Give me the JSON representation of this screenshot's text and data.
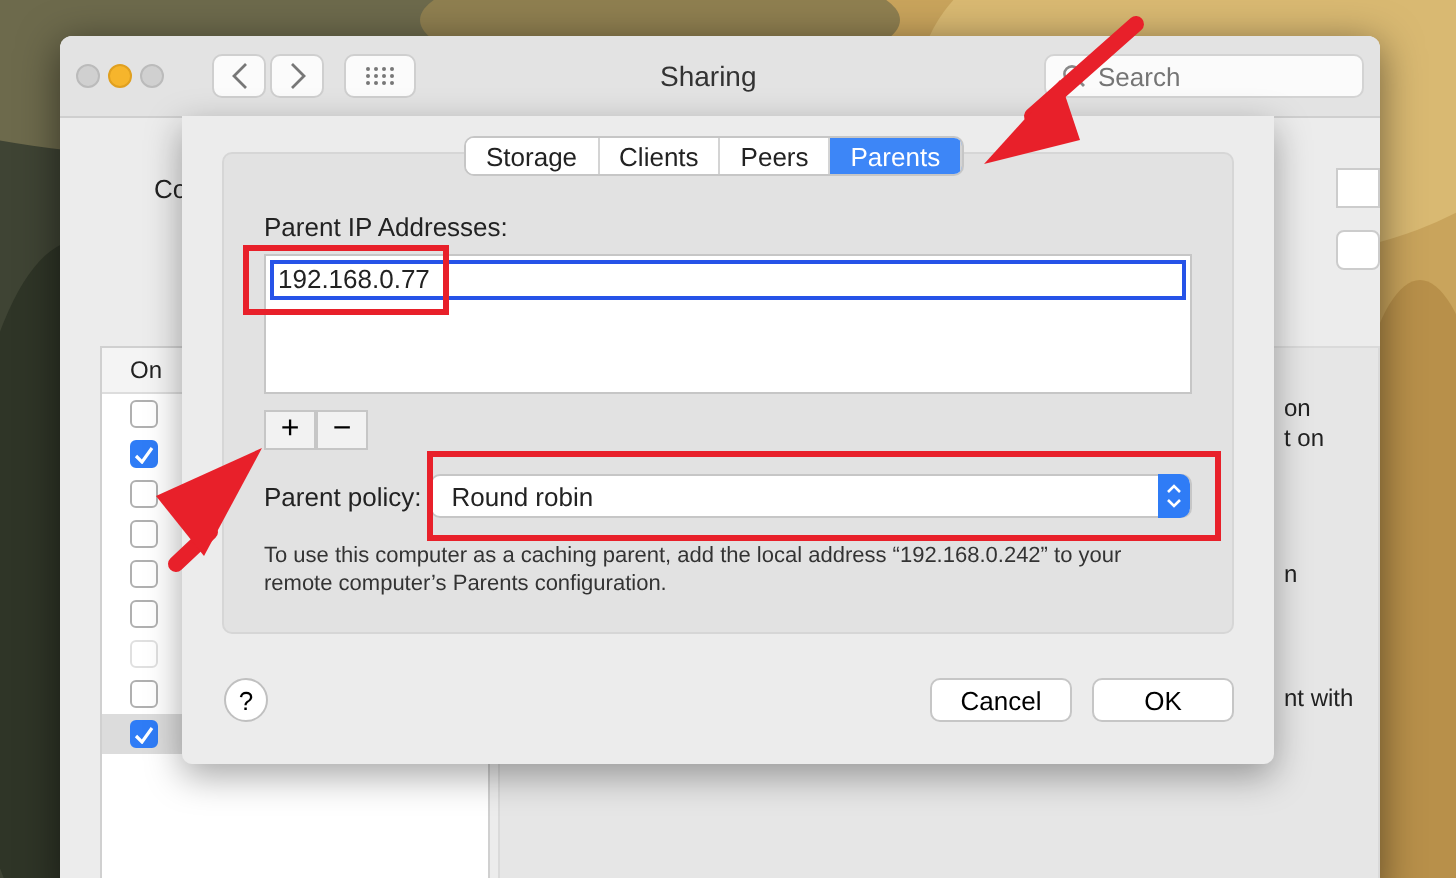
{
  "window": {
    "title": "Sharing",
    "search": {
      "placeholder": "Search"
    }
  },
  "background": {
    "label_fragment": "Co",
    "list_header": "On",
    "services": [
      {
        "checked": false,
        "disabled": false,
        "selected": false
      },
      {
        "checked": true,
        "disabled": false,
        "selected": false
      },
      {
        "checked": false,
        "disabled": false,
        "selected": false
      },
      {
        "checked": false,
        "disabled": false,
        "selected": false
      },
      {
        "checked": false,
        "disabled": false,
        "selected": false
      },
      {
        "checked": false,
        "disabled": false,
        "selected": false
      },
      {
        "checked": false,
        "disabled": true,
        "selected": false
      },
      {
        "checked": false,
        "disabled": false,
        "selected": false
      },
      {
        "checked": true,
        "disabled": false,
        "selected": true
      }
    ],
    "text_fragments": [
      "on",
      "t on",
      "n",
      "nt with"
    ]
  },
  "sheet": {
    "tabs": [
      {
        "label": "Storage",
        "selected": false
      },
      {
        "label": "Clients",
        "selected": false
      },
      {
        "label": "Peers",
        "selected": false
      },
      {
        "label": "Parents",
        "selected": true
      }
    ],
    "addresses_label": "Parent IP Addresses:",
    "addresses": [
      "192.168.0.77"
    ],
    "add_button": "+",
    "remove_button": "−",
    "policy_label": "Parent policy:",
    "policy_value": "Round robin",
    "info": "To use this computer as a caching parent, add the local address “192.168.0.242” to your remote computer’s Parents configuration.",
    "help_button": "?",
    "buttons": [
      "Cancel",
      "OK"
    ]
  }
}
